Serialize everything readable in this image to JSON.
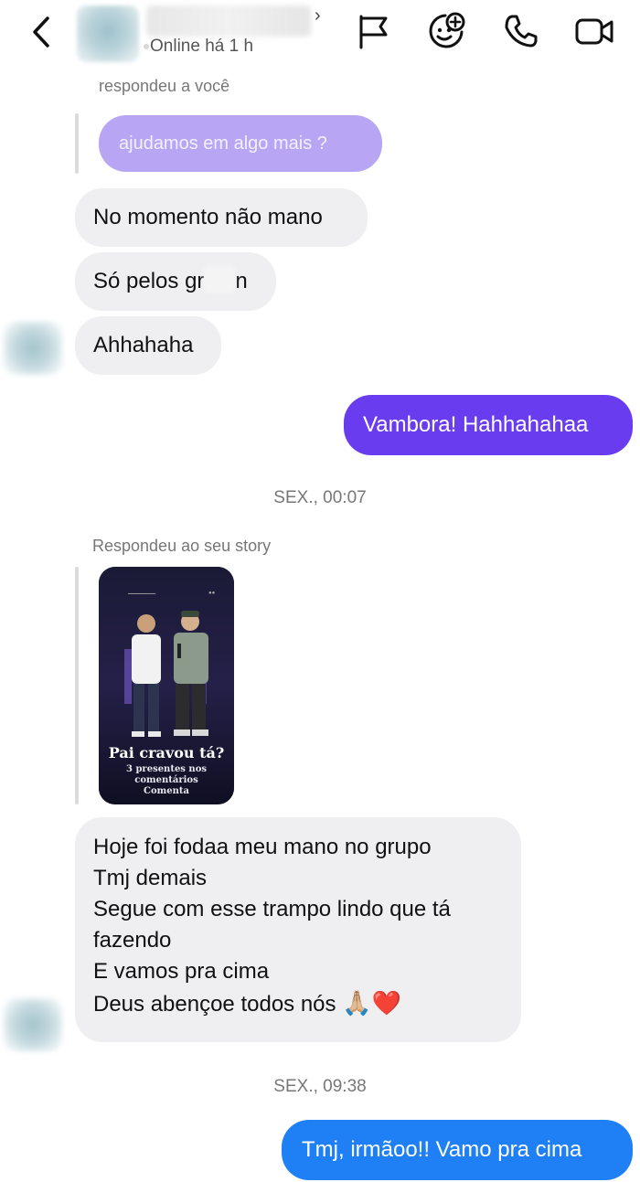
{
  "header": {
    "online_status": "Online há 1 h",
    "chevron": "›",
    "icons": [
      "back-icon",
      "flag-icon",
      "effects-icon",
      "phone-icon",
      "video-icon"
    ]
  },
  "messages": {
    "reply_label_1": "respondeu a você",
    "quoted_text": "ajudamos em algo mais ?",
    "in_1": "No momento não mano",
    "in_2_prefix": "Só pelos gr",
    "in_2_suffix": "n",
    "in_3": "Ahhahaha",
    "out_1": "Vambora! Hahhahahaa",
    "timestamp_1": "SEX., 00:07",
    "reply_label_2": "Respondeu ao seu story",
    "story_caption_title": "Pai cravou tá?",
    "story_caption_sub_1": "3 presentes nos comentários",
    "story_caption_sub_2": "Comenta",
    "in_long_lines": "Hoje foi fodaa meu mano no grupo\nTmj demais\nSegue com esse trampo lindo que tá\nfazendo\nE vamos pra cima",
    "in_long_last": "Deus abençoe todos nós",
    "emojis": "🙏🏼❤️",
    "timestamp_2": "SEX., 09:38",
    "out_2": "Tmj, irmãoo!! Vamo pra cima"
  },
  "colors": {
    "quoted_bubble": "#b8a6f4",
    "out_purple": "#6a3cf0",
    "out_blue": "#1f80f5",
    "incoming": "#efeff1"
  }
}
